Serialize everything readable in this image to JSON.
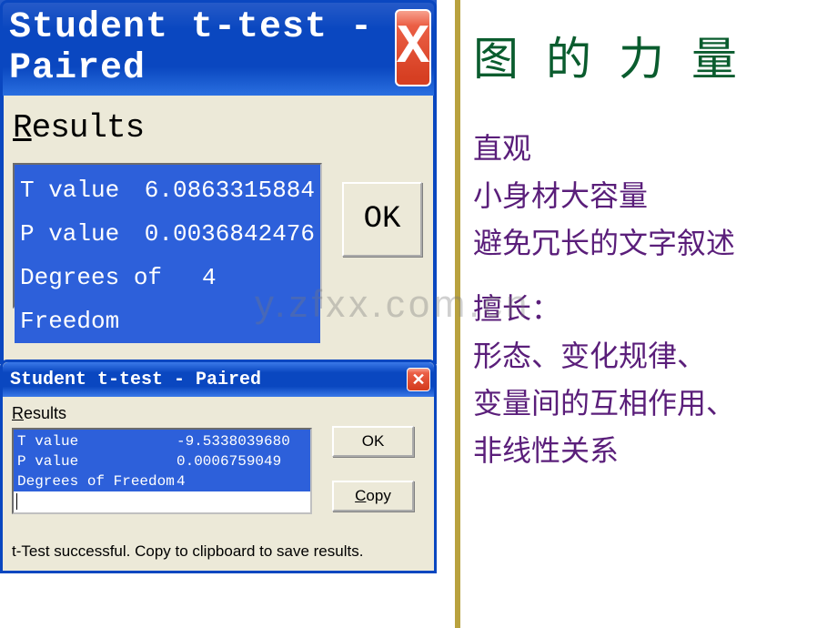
{
  "window1": {
    "title": "Student t-test - Paired",
    "close_label": "X",
    "results_label_underline": "R",
    "results_label_rest": "esults",
    "rows": [
      {
        "label": "T value",
        "value": "6.0863315884"
      },
      {
        "label": "P value",
        "value": "0.0036842476"
      },
      {
        "label": "Degrees of Freedom",
        "value": "4"
      }
    ],
    "ok_label": "OK"
  },
  "window2": {
    "title": "Student t-test - Paired",
    "close_label": "✕",
    "results_label_underline": "R",
    "results_label_rest": "esults",
    "rows": [
      {
        "label": "T value",
        "value": "-9.5338039680"
      },
      {
        "label": "P value",
        "value": "0.0006759049"
      },
      {
        "label": "Degrees of Freedom",
        "value": "4"
      }
    ],
    "ok_label": "OK",
    "copy_underline": "C",
    "copy_rest": "opy",
    "status": "t-Test successful.  Copy to clipboard to save results."
  },
  "right": {
    "heading": "图的力量",
    "line1": "直观",
    "line2": "小身材大容量",
    "line3": "避免冗长的文字叙述",
    "line4": "擅长：",
    "line5": "形态、变化规律、",
    "line6": "变量间的互相作用、",
    "line7": "非线性关系"
  },
  "watermark": "y.zfxx.com.cn"
}
